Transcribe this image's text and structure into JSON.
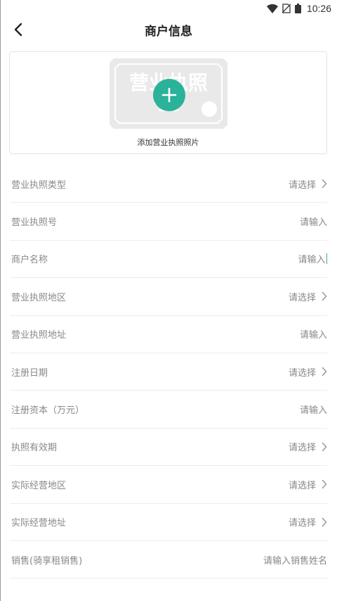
{
  "status_bar": {
    "time": "10:26"
  },
  "header": {
    "title": "商户信息"
  },
  "upload": {
    "placeholder_text": "营业执照",
    "label": "添加营业执照照片"
  },
  "form": {
    "rows": [
      {
        "label": "营业执照类型",
        "value": "请选择",
        "chevron": true
      },
      {
        "label": "营业执照号",
        "value": "请输入",
        "chevron": false
      },
      {
        "label": "商户名称",
        "value": "请输入",
        "chevron": false,
        "focused": true
      },
      {
        "label": "营业执照地区",
        "value": "请选择",
        "chevron": true
      },
      {
        "label": "营业执照地址",
        "value": "请输入",
        "chevron": false
      },
      {
        "label": "注册日期",
        "value": "请选择",
        "chevron": true
      },
      {
        "label": "注册资本（万元）",
        "value": "请输入",
        "chevron": false
      },
      {
        "label": "执照有效期",
        "value": "请选择",
        "chevron": true
      },
      {
        "label": "实际经营地区",
        "value": "请选择",
        "chevron": true
      },
      {
        "label": "实际经营地址",
        "value": "请选择",
        "chevron": true
      },
      {
        "label": "销售(骑享租销售)",
        "value": "请输入销售姓名",
        "chevron": false
      }
    ]
  },
  "colors": {
    "accent": "#2bb29a",
    "divider": "#ececec",
    "muted_text": "#888888"
  }
}
